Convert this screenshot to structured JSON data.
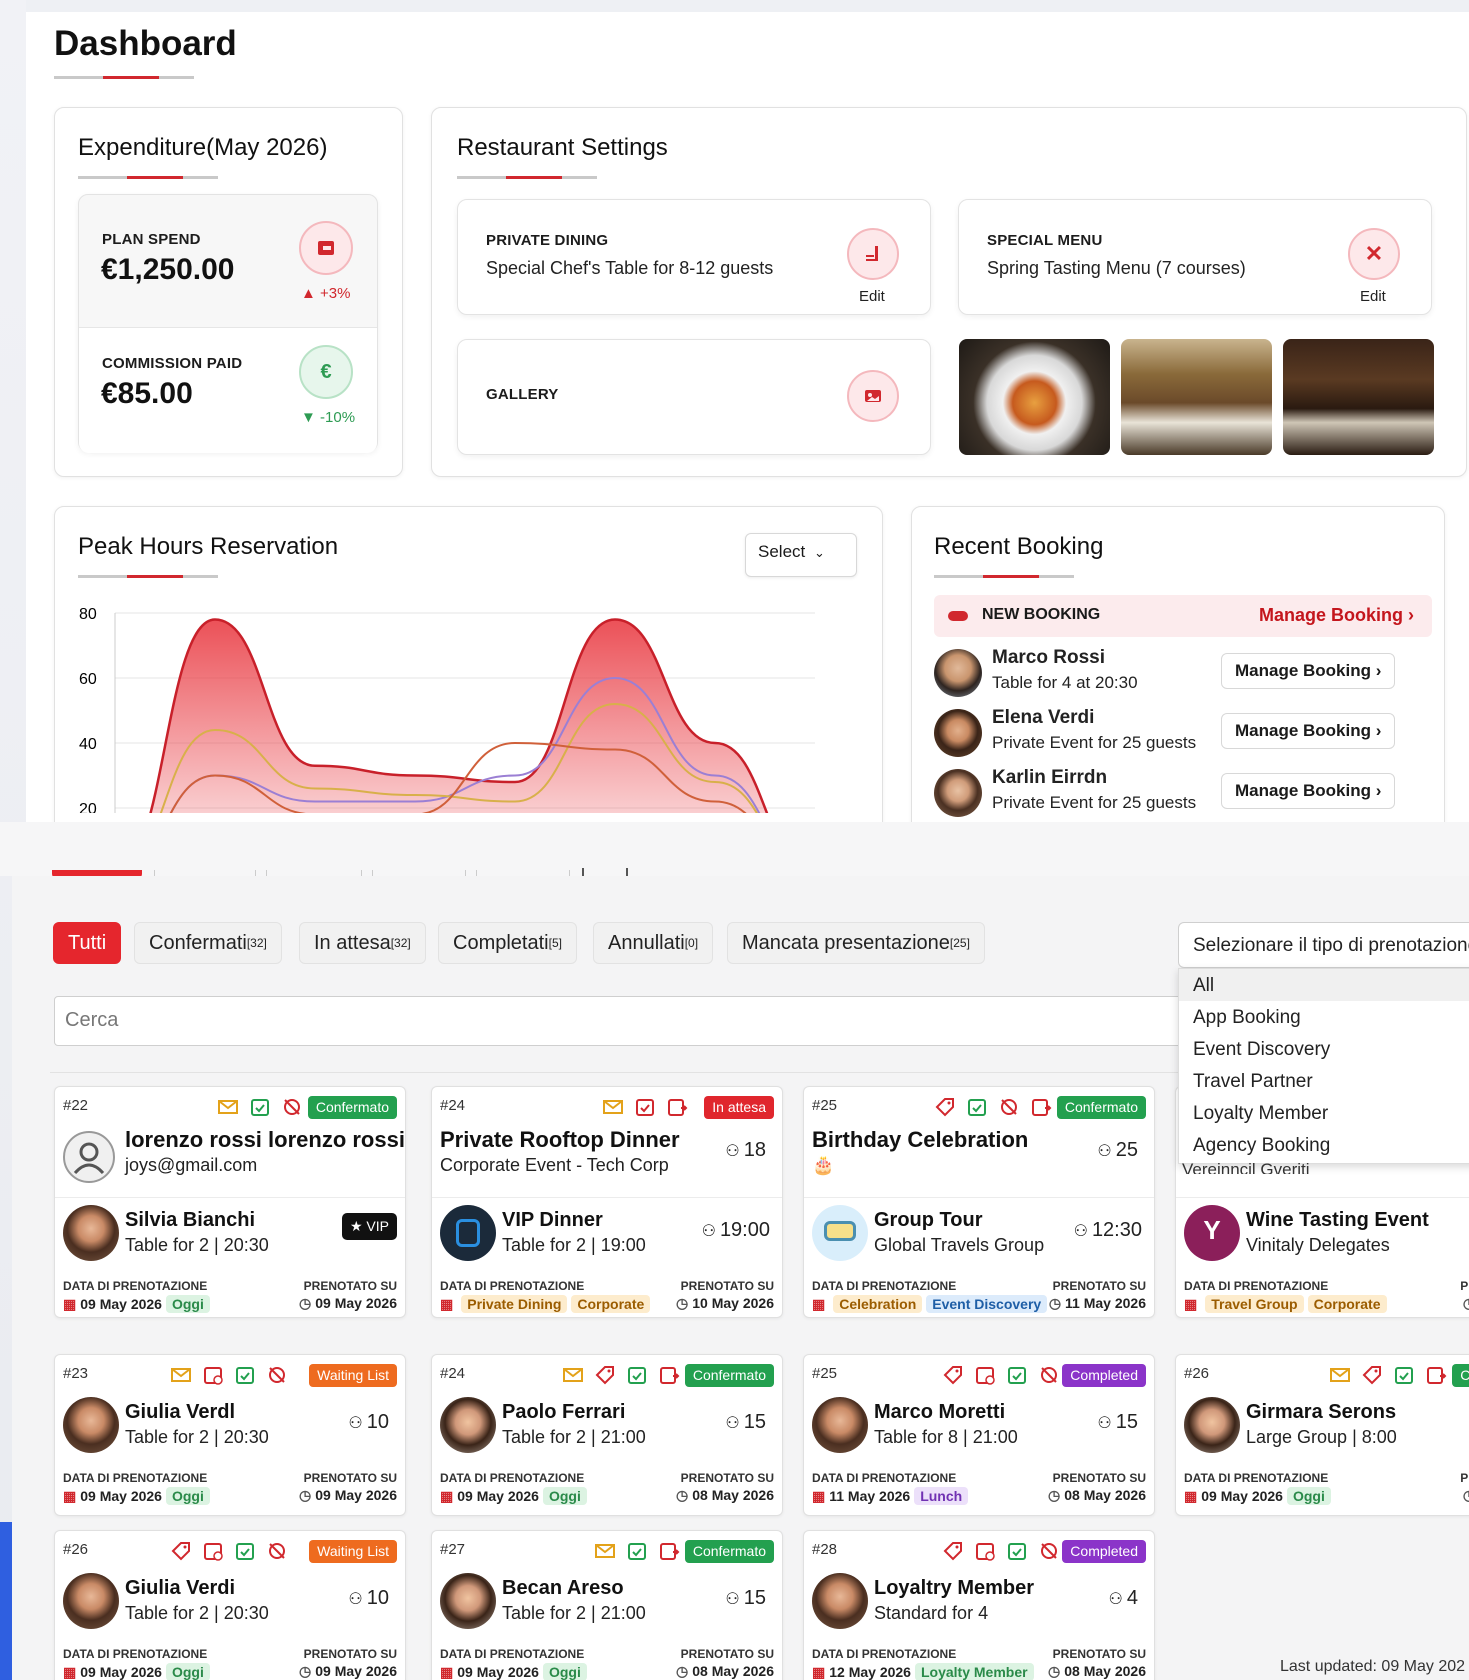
{
  "page": {
    "title": "Dashboard"
  },
  "expenditure": {
    "title": "Expenditure(May 2026)",
    "plan_label": "PLAN SPEND",
    "plan_value": "€1,250.00",
    "plan_delta": "+3%",
    "commission_label": "COMMISSION PAID",
    "commission_value": "€85.00",
    "commission_delta": "-10%"
  },
  "settings": {
    "title": "Restaurant Settings",
    "private_label": "PRIVATE DINING",
    "private_desc": "Special Chef's Table for 8-12 guests",
    "special_label": "SPECIAL MENU",
    "special_desc": "Spring Tasting Menu (7 courses)",
    "edit": "Edit",
    "gallery_label": "GALLERY"
  },
  "peak": {
    "title": "Peak Hours Reservation",
    "select": "Select"
  },
  "chart_data": {
    "type": "area",
    "title": "Peak Hours Reservation",
    "ylim": [
      0,
      80
    ],
    "yticks": [
      0,
      20,
      40,
      60,
      80
    ],
    "series": [
      {
        "color": "#c8202a",
        "values": [
          0,
          78,
          33,
          30,
          28,
          78,
          40,
          0
        ]
      },
      {
        "color": "#9b7fd4",
        "values": [
          0,
          30,
          22,
          22,
          30,
          60,
          30,
          0
        ]
      },
      {
        "color": "#d8b04a",
        "values": [
          0,
          44,
          26,
          24,
          22,
          52,
          28,
          0
        ]
      },
      {
        "color": "#d0603a",
        "values": [
          0,
          30,
          18,
          18,
          40,
          38,
          22,
          0
        ]
      }
    ]
  },
  "recent": {
    "title": "Recent Booking",
    "new_label": "NEW BOOKING",
    "manage": "Manage Booking",
    "items": [
      {
        "name": "Marco Rossi",
        "desc": "Table for 4 at 20:30"
      },
      {
        "name": "Elena Verdi",
        "desc": "Private Event for 25 guests"
      },
      {
        "name": "Karlin Eirrdn",
        "desc": "Private Event for 25 guests"
      }
    ]
  },
  "filters": {
    "tabs": [
      {
        "label": "Tutti",
        "count": ""
      },
      {
        "label": "Confermati",
        "count": "[32]"
      },
      {
        "label": "In attesa",
        "count": "[32]"
      },
      {
        "label": "Completati",
        "count": "[5]"
      },
      {
        "label": "Annullati",
        "count": "[0]"
      },
      {
        "label": "Mancata presentazione",
        "count": "[25]"
      }
    ],
    "search_placeholder": "Cerca",
    "select_label": "Selezionare il tipo di prenotazione",
    "options": [
      "All",
      "App Booking",
      "Event Discovery",
      "Travel Partner",
      "Loyalty Member",
      "Agency Booking"
    ],
    "partial_option": "Vereinncil Gveriti"
  },
  "labels": {
    "booking_date": "DATA DI PRENOTAZIONE",
    "booked_on": "PRENOTATO SU",
    "vip": "★ VIP",
    "booked_on_short": "PRENOTA"
  },
  "bookings": [
    {
      "id": "#22",
      "status": "Confermato",
      "name": "lorenzo rossi lorenzo rossi",
      "sub": "joys@gmail.com",
      "guest": "Silvia Bianchi",
      "gdesc": "Table for 2 | 20:30",
      "date": "09 May 2026",
      "tag": "Oggi",
      "booked": "09 May 2026"
    },
    {
      "id": "#24",
      "status": "In attesa",
      "name": "Private Rooftop Dinner",
      "sub": "Corporate Event - Tech Corp",
      "count": "18",
      "guest": "VIP Dinner",
      "gdesc": "Table for 2 | 19:00",
      "time": "19:00",
      "tag": "Private Dining",
      "tag2": "Corporate",
      "booked": "10 May 2026"
    },
    {
      "id": "#25",
      "status": "Confermato",
      "name": "Birthday Celebration",
      "count": "25",
      "guest": "Group Tour",
      "gdesc": "Global Travels Group",
      "time": "12:30",
      "tag": "Celebration",
      "tag2": "Event Discovery",
      "booked": "11 May 2026"
    },
    {
      "guest": "Wine Tasting Event",
      "gdesc": "Vinitaly Delegates",
      "tag": "Travel Group",
      "tag2": "Corporate",
      "booked": "12 Ma"
    },
    {
      "id": "#23",
      "status": "Waiting List",
      "guest": "Giulia Verdl",
      "gdesc": "Table for 2 | 20:30",
      "count": "10",
      "date": "09 May 2026",
      "tag": "Oggi",
      "booked": "09 May 2026"
    },
    {
      "id": "#24",
      "status": "Confermato",
      "guest": "Paolo Ferrari",
      "gdesc": "Table for 2 | 21:00",
      "count": "15",
      "date": "09 May 2026",
      "tag": "Oggi",
      "booked": "08 May 2026"
    },
    {
      "id": "#25",
      "status": "Completed",
      "guest": "Marco Moretti",
      "gdesc": "Table for 8 | 21:00",
      "count": "15",
      "date": "11 May 2026",
      "tag": "Lunch",
      "booked": "08 May 2026"
    },
    {
      "id": "#26",
      "status": "Confern",
      "guest": "Girmara Serons",
      "gdesc": "Large Group | 8:00",
      "date": "09 May 2026",
      "tag": "Oggi",
      "booked": "08 Ma"
    },
    {
      "id": "#26",
      "status": "Waiting List",
      "guest": "Giulia Verdi",
      "gdesc": "Table for 2 | 20:30",
      "count": "10",
      "date": "09 May 2026",
      "tag": "Oggi",
      "booked": "09 May 2026"
    },
    {
      "id": "#27",
      "status": "Confermato",
      "guest": "Becan Areso",
      "gdesc": "Table for 2 | 21:00",
      "count": "15",
      "date": "09 May 2026",
      "tag": "Oggi",
      "booked": "08 May 2026"
    },
    {
      "id": "#28",
      "status": "Completed",
      "guest": "Loyaltry Member",
      "gdesc": "Standard for 4",
      "count": "4",
      "date": "12 May 2026",
      "tag": "Loyalty Member",
      "booked": "08 May 2026"
    }
  ],
  "footer": {
    "last_updated": "Last updated: 09 May 202"
  },
  "colors": {
    "accent": "#d1282e",
    "green": "#23a04f",
    "purple": "#8b34c9",
    "orange": "#ee6b1f"
  }
}
